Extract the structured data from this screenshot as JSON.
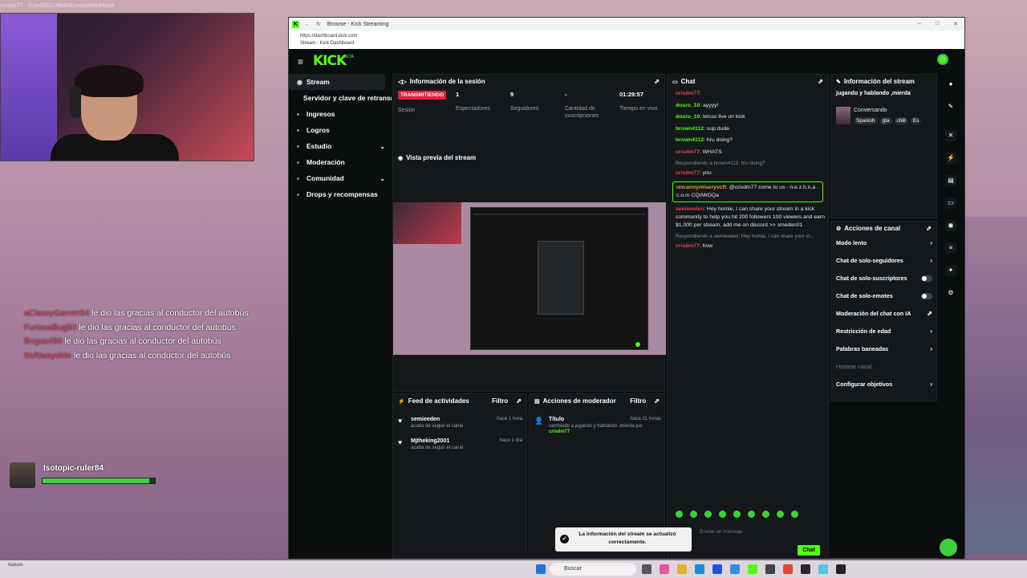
{
  "overlay": {
    "top_text": "crisdm77 · 2c3e52021f4b4031ee0c94fce4a08",
    "feed": [
      {
        "user": "aClassyGamer94",
        "text": " le dio las gracias al conductor del autobús"
      },
      {
        "user": "FuriousBug50",
        "text": " le dio las gracias al conductor del autobús"
      },
      {
        "user": "Bogus490",
        "text": " le dio las gracias al conductor del autobús"
      },
      {
        "user": "ItsAlwaysMe",
        "text": " le dio las gracias al conductor del autobús"
      }
    ],
    "player_name": "Isotopic-ruler84",
    "player_health": 0.95
  },
  "browser": {
    "title": "Browse - Kick Streaming",
    "url": "https://dashboard.kick.com",
    "url_title": "Stream - Kick Dashboard"
  },
  "kick": {
    "logo": "KICK",
    "beta": "BETA"
  },
  "sidebar": {
    "items": [
      {
        "label": "Stream",
        "icon": "broadcast-icon"
      },
      {
        "label": "Servidor y clave de retransmisión",
        "icon": ""
      },
      {
        "label": "Ingresos",
        "icon": "money-icon"
      },
      {
        "label": "Logros",
        "icon": "trophy-icon"
      },
      {
        "label": "Estudio",
        "icon": "studio-icon"
      },
      {
        "label": "Moderación",
        "icon": "shield-icon"
      },
      {
        "label": "Comunidad",
        "icon": "community-icon"
      },
      {
        "label": "Drops y recompensas",
        "icon": "gift-icon"
      }
    ]
  },
  "session": {
    "title": "Información de la sesión",
    "status": "TRANSMITIENDO",
    "status_label": "Sesión",
    "viewers": "1",
    "viewers_label": "Espectadores",
    "followers": "9",
    "followers_label": "Seguidores",
    "subs": "-",
    "subs_label": "Cantidad de suscripciones",
    "uptime": "01:29:57",
    "uptime_label": "Tiempo en vivo"
  },
  "preview": {
    "title": "Vista previa del stream"
  },
  "chat": {
    "title": "Chat",
    "messages": [
      {
        "user": "crisdm77",
        "color": "#e8415a",
        "text": ":",
        "kind": "msg"
      },
      {
        "user": "dosro_10",
        "color": "#53fc18",
        "text": ": ayyyy!",
        "kind": "msg"
      },
      {
        "user": "dosro_10",
        "color": "#53fc18",
        "text": ": letsss live on kick",
        "kind": "msg"
      },
      {
        "user": "brown4112",
        "color": "#53fc18",
        "text": ": sup dude",
        "kind": "msg"
      },
      {
        "user": "brown4112",
        "color": "#53fc18",
        "text": ": hru doing?",
        "kind": "msg"
      },
      {
        "user": "crisdm77",
        "color": "#e8415a",
        "text": ": WHATS",
        "kind": "msg"
      },
      {
        "user": "",
        "color": "#8a9096",
        "text": "Respondiendo a brown4112: hru doing?",
        "kind": "reply"
      },
      {
        "user": "crisdm77",
        "color": "#e8415a",
        "text": ": you",
        "kind": "msg"
      },
      {
        "user": "uncannymiseryvcft",
        "color": "#f0a23a",
        "text": ": @crisdm77 come to us - n.e.z.h.n.a . c.o.m CQrMrDQa",
        "kind": "hl"
      },
      {
        "user": "semieeden",
        "color": "#e8415a",
        "text": ": Hey homie, I can share your stream in a kick community to help you hit 200 followers 100 viewers and earn $1,000 per stream, add me on discord >> smeden01",
        "kind": "msg"
      },
      {
        "user": "",
        "color": "#8a9096",
        "text": "Respondiendo a semieeden: Hey homie, I can share your st...",
        "kind": "reply"
      },
      {
        "user": "crisdm77",
        "color": "#e8415a",
        "text": ": how",
        "kind": "msg"
      }
    ],
    "input_placeholder": "Enviar un mensaje",
    "send_label": "Chat"
  },
  "stream_info": {
    "title": "Información del stream",
    "stream_title": "jugando y hablando ,mierda",
    "category": "Conversando",
    "tags": [
      "Spanish",
      "gta",
      "chill",
      "Es"
    ]
  },
  "channel_actions": {
    "title": "Acciones de canal",
    "options": [
      {
        "label": "Modo lento",
        "control": "chevron"
      },
      {
        "label": "Chat de solo-seguidores",
        "control": "chevron"
      },
      {
        "label": "Chat de solo-suscriptores",
        "control": "toggle"
      },
      {
        "label": "Chat de solo-emotes",
        "control": "toggle"
      },
      {
        "label": "Moderación del chat con IA",
        "control": "external"
      },
      {
        "label": "Restricción de edad",
        "control": "chevron"
      },
      {
        "label": "Palabras baneadas",
        "control": "chevron"
      },
      {
        "label": "Hostear canal",
        "control": "disabled"
      },
      {
        "label": "Configurar objetivos",
        "control": "chevron"
      }
    ]
  },
  "activity": {
    "title": "Feed de actividades",
    "filter": "Filtro",
    "items": [
      {
        "user": "semieeden",
        "sub": "acaba de seguir el canal",
        "time": "hace 1 hora"
      },
      {
        "user": "Mjtheking2001",
        "sub": "acaba de seguir el canal",
        "time": "hace 1 día"
      }
    ]
  },
  "mod_actions": {
    "title": "Acciones de moderador",
    "filter": "Filtro",
    "item_title": "Título",
    "item_time": "hace 21 horas",
    "item_text": "cambiado a jugando y hablando ,mierda por",
    "item_user": "crisdm77"
  },
  "toast": {
    "text": "La información del stream se actualizó correctamente."
  },
  "taskbar": {
    "search": "Buscar",
    "left": "Nublado"
  }
}
